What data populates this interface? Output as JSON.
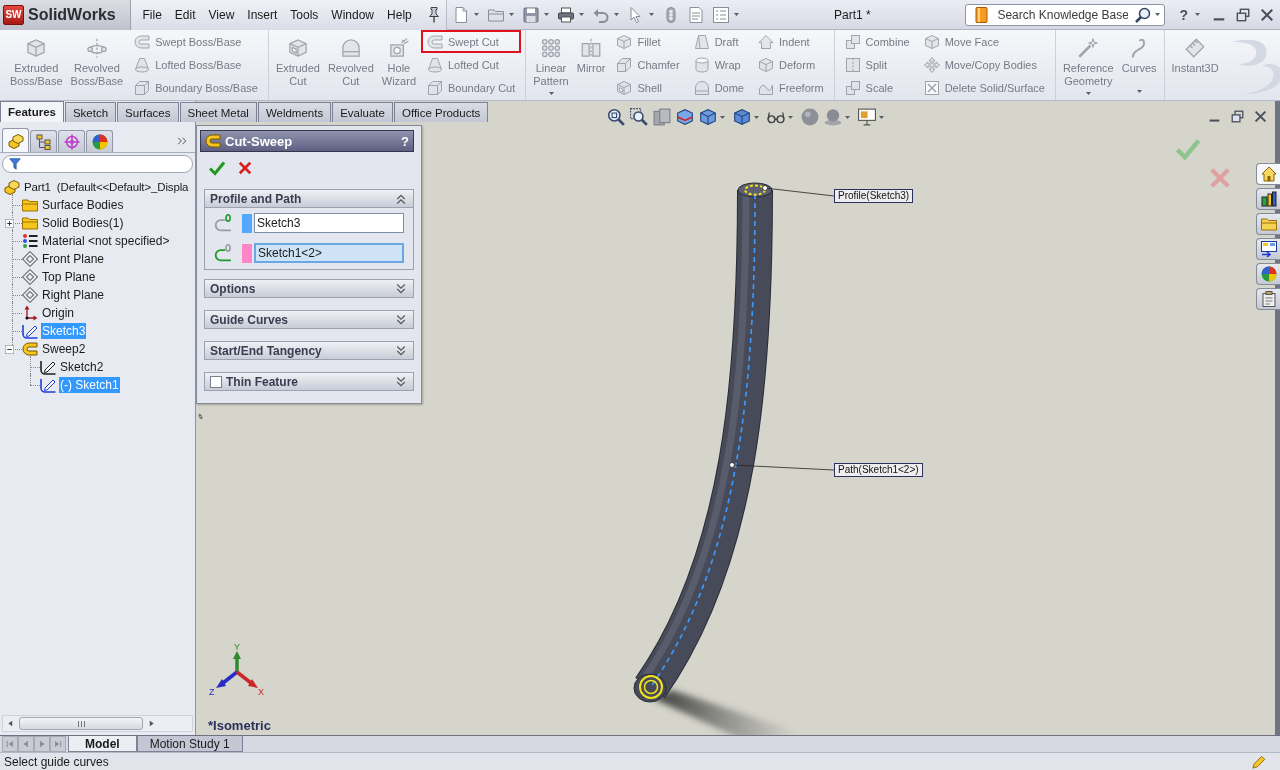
{
  "title_bar": {
    "logo": {
      "mark": "SW",
      "name": "SolidWorks"
    },
    "menu": [
      "File",
      "Edit",
      "View",
      "Insert",
      "Tools",
      "Window",
      "Help"
    ],
    "document_title": "Part1 *",
    "search": {
      "placeholder": "Search Knowledge Base"
    },
    "help": "?"
  },
  "command_manager": {
    "disabled": true,
    "groups": [
      {
        "items": [
          {
            "kind": "large",
            "label": "Extruded Boss/Base",
            "dropdown": false
          },
          {
            "kind": "large",
            "label": "Revolved Boss/Base",
            "dropdown": false
          },
          {
            "kind": "stack",
            "items": [
              {
                "label": "Swept Boss/Base",
                "highlighted": false
              },
              {
                "label": "Lofted Boss/Base",
                "highlighted": false
              },
              {
                "label": "Boundary Boss/Base",
                "highlighted": false
              }
            ]
          }
        ]
      },
      {
        "items": [
          {
            "kind": "large",
            "label": "Extruded Cut",
            "dropdown": false
          },
          {
            "kind": "large",
            "label": "Revolved Cut",
            "dropdown": false
          },
          {
            "kind": "large",
            "label": "Hole Wizard",
            "dropdown": false
          },
          {
            "kind": "stack",
            "items": [
              {
                "label": "Swept Cut",
                "highlighted": true
              },
              {
                "label": "Lofted Cut",
                "highlighted": false
              },
              {
                "label": "Boundary Cut",
                "highlighted": false
              }
            ]
          }
        ]
      },
      {
        "items": [
          {
            "kind": "large",
            "label": "Linear Pattern",
            "dropdown": true
          },
          {
            "kind": "large",
            "label": "Mirror",
            "dropdown": false
          },
          {
            "kind": "stack",
            "items": [
              {
                "label": "Fillet",
                "highlighted": false
              },
              {
                "label": "Chamfer",
                "highlighted": false
              },
              {
                "label": "Shell",
                "highlighted": false
              }
            ]
          },
          {
            "kind": "stack",
            "items": [
              {
                "label": "Draft",
                "highlighted": false
              },
              {
                "label": "Wrap",
                "highlighted": false
              },
              {
                "label": "Dome",
                "highlighted": false
              }
            ]
          },
          {
            "kind": "stack",
            "items": [
              {
                "label": "Indent",
                "highlighted": false
              },
              {
                "label": "Deform",
                "highlighted": false
              },
              {
                "label": "Freeform",
                "highlighted": false
              }
            ]
          }
        ]
      },
      {
        "items": [
          {
            "kind": "stack",
            "items": [
              {
                "label": "Combine",
                "highlighted": false
              },
              {
                "label": "Split",
                "highlighted": false
              },
              {
                "label": "Scale",
                "highlighted": false
              }
            ]
          },
          {
            "kind": "stack",
            "items": [
              {
                "label": "Move Face",
                "highlighted": false
              },
              {
                "label": "Move/Copy Bodies",
                "highlighted": false
              },
              {
                "label": "Delete Solid/Surface",
                "highlighted": false
              }
            ]
          }
        ]
      },
      {
        "items": [
          {
            "kind": "large",
            "label": "Reference Geometry",
            "dropdown": true
          },
          {
            "kind": "large",
            "label": "Curves",
            "dropdown": true
          }
        ]
      },
      {
        "items": [
          {
            "kind": "large",
            "label": "Instant3D",
            "dropdown": false
          }
        ]
      }
    ]
  },
  "tabs": [
    {
      "label": "Features",
      "selected": true
    },
    {
      "label": "Sketch",
      "selected": false
    },
    {
      "label": "Surfaces",
      "selected": false
    },
    {
      "label": "Sheet Metal",
      "selected": false
    },
    {
      "label": "Weldments",
      "selected": false
    },
    {
      "label": "Evaluate",
      "selected": false
    },
    {
      "label": "Office Products",
      "selected": false
    }
  ],
  "feature_manager": {
    "tabs": [
      {
        "selected": true
      },
      {
        "selected": false
      },
      {
        "selected": false
      },
      {
        "selected": false
      }
    ],
    "tree": [
      {
        "label": "Part1  (Default<<Default>_Displa",
        "kind": "part",
        "selected": false,
        "children": [
          {
            "label": "Surface Bodies",
            "kind": "folder",
            "selected": false
          },
          {
            "label": "Solid Bodies(1)",
            "kind": "folder",
            "selected": false,
            "expanded": false
          },
          {
            "label": "Material <not specified>",
            "kind": "material",
            "selected": false
          },
          {
            "label": "Front Plane",
            "kind": "plane",
            "selected": false
          },
          {
            "label": "Top Plane",
            "kind": "plane",
            "selected": false
          },
          {
            "label": "Right Plane",
            "kind": "plane",
            "selected": false
          },
          {
            "label": "Origin",
            "kind": "origin",
            "selected": false
          },
          {
            "label": "Sketch3",
            "kind": "sketch",
            "selected": true
          },
          {
            "label": "Sweep2",
            "kind": "sweep",
            "selected": false,
            "expanded": true,
            "children": [
              {
                "label": "Sketch2",
                "kind": "sketch",
                "selected": false
              },
              {
                "label": "(-) Sketch1",
                "kind": "sketch",
                "selected": true
              }
            ]
          }
        ]
      }
    ]
  },
  "property_manager": {
    "title": "Cut-Sweep",
    "help": "?",
    "sections": [
      {
        "title": "Profile and Path",
        "kind": "plain",
        "expanded": true,
        "fields": [
          {
            "kind": "profile",
            "value": "Sketch3",
            "color": "#55a8ff",
            "selected": false
          },
          {
            "kind": "path",
            "value": "Sketch1<2>",
            "color": "#ff85c8",
            "selected": true
          }
        ]
      },
      {
        "title": "Options",
        "kind": "plain",
        "expanded": false
      },
      {
        "title": "Guide Curves",
        "kind": "plain",
        "expanded": false
      },
      {
        "title": "Start/End Tangency",
        "kind": "plain",
        "expanded": false
      },
      {
        "title": "Thin Feature",
        "kind": "checkbox",
        "checked": false,
        "expanded": false
      }
    ]
  },
  "viewport": {
    "callouts": [
      {
        "label": "Profile(Sketch3)"
      },
      {
        "label": "Path(Sketch1<2>)"
      }
    ],
    "triad": {
      "x": "X",
      "y": "Y",
      "z": "Z"
    },
    "view_label": "*Isometric"
  },
  "task_pane": {
    "tabs": [
      {
        "selected": true
      },
      {
        "selected": false
      },
      {
        "selected": false
      },
      {
        "selected": false
      },
      {
        "selected": false
      },
      {
        "selected": false
      }
    ]
  },
  "bottom_tabs": [
    {
      "label": "Model",
      "selected": true
    },
    {
      "label": "Motion Study 1",
      "selected": false
    }
  ],
  "status_bar": {
    "message": "Select guide curves"
  }
}
